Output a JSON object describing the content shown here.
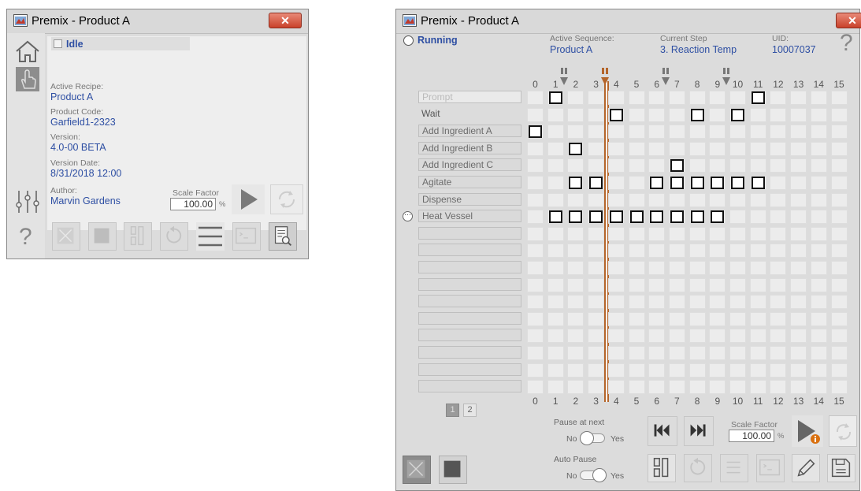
{
  "left_window": {
    "title": "Premix - Product A",
    "close_label": "✕",
    "state": "Idle",
    "active_recipe_label": "Active Recipe:",
    "active_recipe": "Product A",
    "product_code_label": "Product Code:",
    "product_code": "Garfield1-2323",
    "version_label": "Version:",
    "version": "4.0-00 BETA",
    "version_date_label": "Version Date:",
    "version_date": "8/31/2018 12:00",
    "author_label": "Author:",
    "author": "Marvin Gardens",
    "scale_factor_label": "Scale Factor",
    "scale_factor": "100.00",
    "scale_unit": "%",
    "help_glyph": "?"
  },
  "right_window": {
    "title": "Premix - Product A",
    "close_label": "✕",
    "state": "Running",
    "active_sequence_label": "Active Sequence:",
    "active_sequence": "Product A",
    "current_step_label": "Current Step",
    "current_step": "3. Reaction Temp",
    "uid_label": "UID:",
    "uid": "10007037",
    "help_glyph": "?",
    "columns": [
      "0",
      "1",
      "2",
      "3",
      "4",
      "5",
      "6",
      "7",
      "8",
      "9",
      "10",
      "11",
      "12",
      "13",
      "14",
      "15"
    ],
    "steps": [
      "Prompt",
      "Wait",
      "Add Ingredient A",
      "Add Ingredient B",
      "Add Ingredient C",
      "Agitate",
      "Dispense",
      "Heat Vessel",
      "",
      "",
      "",
      "",
      "",
      "",
      "",
      "",
      "",
      ""
    ],
    "active_step_index": 7,
    "current_column": 3,
    "breakpoint_columns": [
      1,
      3,
      6,
      9
    ],
    "marks": [
      [
        0,
        1
      ],
      [
        0,
        11
      ],
      [
        1,
        4
      ],
      [
        1,
        8
      ],
      [
        1,
        10
      ],
      [
        2,
        0
      ],
      [
        3,
        2
      ],
      [
        4,
        7
      ],
      [
        5,
        2
      ],
      [
        5,
        3
      ],
      [
        5,
        6
      ],
      [
        5,
        7
      ],
      [
        5,
        8
      ],
      [
        5,
        9
      ],
      [
        5,
        10
      ],
      [
        5,
        11
      ],
      [
        7,
        1
      ],
      [
        7,
        2
      ],
      [
        7,
        3
      ],
      [
        7,
        4
      ],
      [
        7,
        5
      ],
      [
        7,
        6
      ],
      [
        7,
        7
      ],
      [
        7,
        8
      ],
      [
        7,
        9
      ]
    ],
    "pages": [
      "1",
      "2"
    ],
    "current_page": 0,
    "pause_at_next_label": "Pause at next",
    "pause_at_next_no": "No",
    "pause_at_next_yes": "Yes",
    "pause_at_next_on": false,
    "auto_pause_label": "Auto Pause",
    "auto_pause_no": "No",
    "auto_pause_yes": "Yes",
    "auto_pause_on": true,
    "scale_factor_label": "Scale Factor",
    "scale_factor": "100.00",
    "scale_unit": "%"
  },
  "colors": {
    "value_blue": "#2e4fa3",
    "cursor_brown": "#b4652a",
    "close_red": "#c9412a"
  }
}
